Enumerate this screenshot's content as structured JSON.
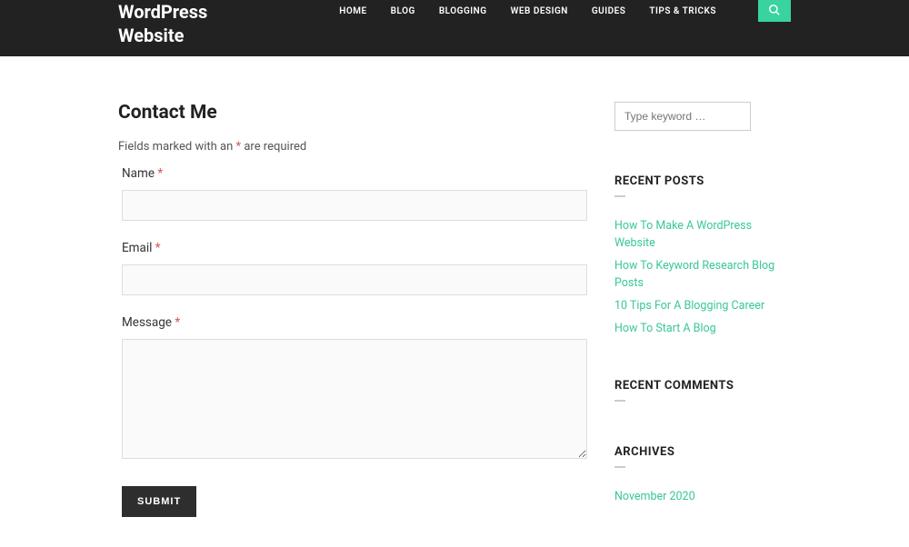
{
  "header": {
    "site_title_line1": "WordPress",
    "site_title_line2": "Website",
    "nav": [
      "HOME",
      "BLOG",
      "BLOGGING",
      "WEB DESIGN",
      "GUIDES",
      "TIPS & TRICKS"
    ]
  },
  "page": {
    "title": "Contact Me",
    "required_prefix": "Fields marked with an ",
    "required_mark": "*",
    "required_suffix": " are required"
  },
  "form": {
    "name_label": "Name ",
    "email_label": "Email ",
    "message_label": "Message ",
    "submit_label": "SUBMIT"
  },
  "sidebar": {
    "search_placeholder": "Type keyword …",
    "recent_posts_title": "RECENT POSTS",
    "recent_posts": [
      "How To Make A WordPress Website",
      "How To Keyword Research Blog Posts",
      "10 Tips For A Blogging Career",
      "How To Start A Blog"
    ],
    "recent_comments_title": "RECENT COMMENTS",
    "archives_title": "ARCHIVES",
    "archives": [
      "November 2020"
    ]
  }
}
